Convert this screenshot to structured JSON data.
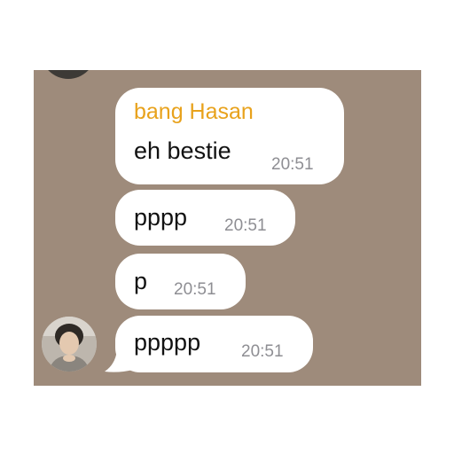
{
  "chat": {
    "background_color": "#9e8b7b",
    "sender_color": "#e8a21c",
    "messages": [
      {
        "sender": "bang Hasan",
        "text": "eh bestie",
        "time": "20:51"
      },
      {
        "text": "pppp",
        "time": "20:51"
      },
      {
        "text": "p",
        "time": "20:51"
      },
      {
        "text": "ppppp",
        "time": "20:51"
      }
    ],
    "avatar_icon": "user-avatar-photo"
  }
}
